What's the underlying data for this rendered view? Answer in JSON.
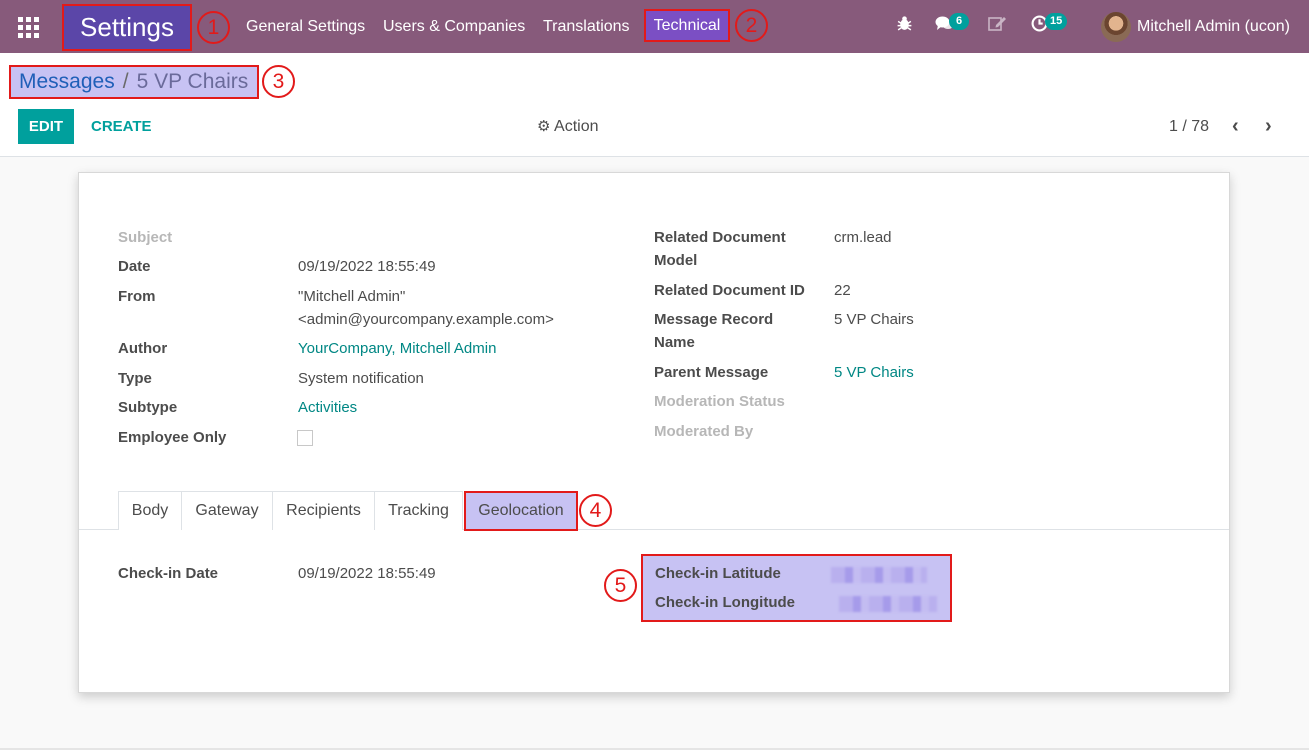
{
  "navbar": {
    "app_title": "Settings",
    "menu": [
      "General Settings",
      "Users & Companies",
      "Translations",
      "Technical"
    ],
    "messages_count": "6",
    "activities_count": "15",
    "user_name": "Mitchell Admin (ucon)"
  },
  "annotations": [
    "1",
    "2",
    "3",
    "4",
    "5"
  ],
  "breadcrumb": {
    "parent": "Messages",
    "separator": "/",
    "current": "5 VP Chairs"
  },
  "control_panel": {
    "edit_label": "EDIT",
    "create_label": "CREATE",
    "action_label": "Action",
    "pager": "1 / 78"
  },
  "form": {
    "left": [
      {
        "label": "Subject",
        "value": ""
      },
      {
        "label": "Date",
        "value": "09/19/2022 18:55:49"
      },
      {
        "label": "From",
        "value_line1": "\"Mitchell Admin\"",
        "value_line2": "<admin@yourcompany.example.com>"
      },
      {
        "label": "Author",
        "value": "YourCompany, Mitchell Admin"
      },
      {
        "label": "Type",
        "value": "System notification"
      },
      {
        "label": "Subtype",
        "value": "Activities"
      },
      {
        "label": "Employee Only",
        "value": false
      }
    ],
    "right": [
      {
        "label_line1": "Related Document",
        "label_line2": "Model",
        "value": "crm.lead"
      },
      {
        "label": "Related Document ID",
        "value": "22"
      },
      {
        "label_line1": "Message Record",
        "label_line2": "Name",
        "value": "5 VP Chairs"
      },
      {
        "label": "Parent Message",
        "value": "5 VP Chairs"
      },
      {
        "label": "Moderation Status",
        "value": ""
      },
      {
        "label": "Moderated By",
        "value": ""
      }
    ]
  },
  "tabs": [
    "Body",
    "Gateway",
    "Recipients",
    "Tracking",
    "Geolocation"
  ],
  "geolocation": {
    "checkin_date_label": "Check-in Date",
    "checkin_date_value": "09/19/2022 18:55:49",
    "latitude_label": "Check-in Latitude",
    "longitude_label": "Check-in Longitude"
  }
}
